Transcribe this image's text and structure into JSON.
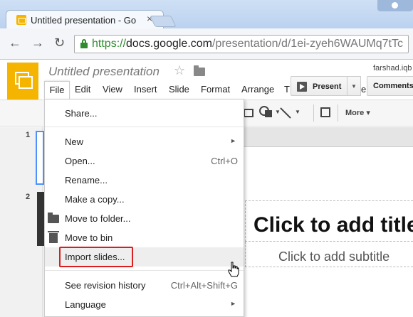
{
  "browser": {
    "tab_title": "Untitled presentation - Go",
    "tab_close": "×",
    "url_scheme": "https://",
    "url_host": "docs.google.com",
    "url_path": "/presentation/d/1ei-zyeh6WAUMq7tTc"
  },
  "app": {
    "doc_title": "Untitled presentation",
    "user_email": "farshad.iqb",
    "present_label": "Present",
    "comments_label": "Comments",
    "menu_ext": "el"
  },
  "menubar": [
    "File",
    "Edit",
    "View",
    "Insert",
    "Slide",
    "Format",
    "Arrange",
    "T"
  ],
  "toolbar": {
    "more_label": "More"
  },
  "filmstrip": {
    "slide_numbers": [
      "1",
      "2"
    ]
  },
  "slide": {
    "title_placeholder": "Click to add title",
    "subtitle_placeholder": "Click to add subtitle"
  },
  "file_menu": {
    "items": [
      {
        "label": "Share...",
        "shortcut": ""
      },
      {
        "label": "New",
        "shortcut": "",
        "submenu": "►"
      },
      {
        "label": "Open...",
        "shortcut": "Ctrl+O"
      },
      {
        "label": "Rename...",
        "shortcut": ""
      },
      {
        "label": "Make a copy...",
        "shortcut": ""
      },
      {
        "label": "Move to folder...",
        "shortcut": ""
      },
      {
        "label": "Move to bin",
        "shortcut": ""
      },
      {
        "label": "Import slides...",
        "shortcut": ""
      },
      {
        "label": "See revision history",
        "shortcut": "Ctrl+Alt+Shift+G"
      },
      {
        "label": "Language",
        "shortcut": "",
        "submenu": "►"
      }
    ]
  },
  "colors": {
    "brand_yellow": "#f4b400",
    "highlight_red": "#d81e1e",
    "selected_blue": "#4d90fe"
  }
}
